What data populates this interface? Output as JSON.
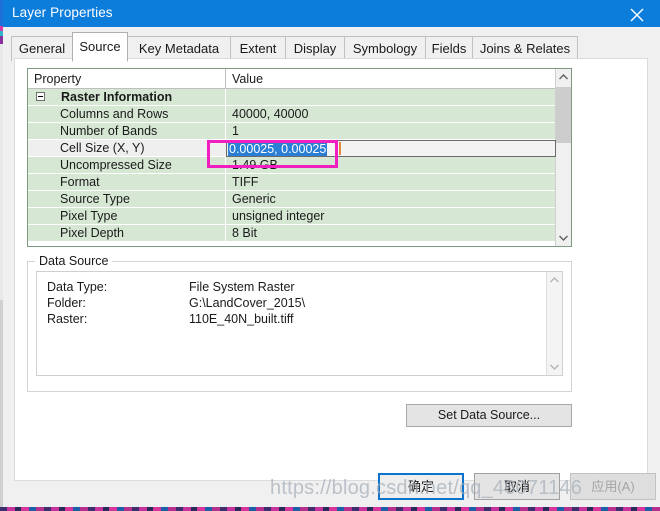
{
  "window": {
    "title": "Layer Properties",
    "close_icon": "close-icon",
    "titlebar_color": "#0d7ddb"
  },
  "tabs": [
    {
      "label": "General",
      "active": false
    },
    {
      "label": "Source",
      "active": true
    },
    {
      "label": "Key Metadata",
      "active": false
    },
    {
      "label": "Extent",
      "active": false
    },
    {
      "label": "Display",
      "active": false
    },
    {
      "label": "Symbology",
      "active": false
    },
    {
      "label": "Fields",
      "active": false
    },
    {
      "label": "Joins & Relates",
      "active": false
    }
  ],
  "grid": {
    "headers": {
      "property": "Property",
      "value": "Value"
    },
    "rows": [
      {
        "name": "Raster Information",
        "value": "",
        "group": true,
        "expanded": true
      },
      {
        "name": "Columns and Rows",
        "value": "40000, 40000"
      },
      {
        "name": "Number of Bands",
        "value": "1"
      },
      {
        "name": "Cell Size (X, Y)",
        "value": "0.00025, 0.00025",
        "editing": true,
        "selected": true
      },
      {
        "name": "Uncompressed Size",
        "value": "1.49 GB"
      },
      {
        "name": "Format",
        "value": "TIFF"
      },
      {
        "name": "Source Type",
        "value": "Generic"
      },
      {
        "name": "Pixel Type",
        "value": "unsigned integer"
      },
      {
        "name": "Pixel Depth",
        "value": "8 Bit"
      }
    ],
    "editor_value": "0.00025, 0.00025",
    "row_background": "#d6e8d4",
    "selection_color": "#2a7fd4"
  },
  "annotation": {
    "color": "#f21fc0",
    "target": "Cell Size (X, Y) value"
  },
  "data_source": {
    "legend": "Data Source",
    "lines": [
      {
        "label": "Data Type:",
        "value": "File System Raster"
      },
      {
        "label": "Folder:",
        "value": "G:\\LandCover_2015\\"
      },
      {
        "label": "Raster:",
        "value": "110E_40N_built.tiff"
      }
    ]
  },
  "buttons": {
    "set_data_source": "Set Data Source...",
    "ok": "确定",
    "cancel": "取消",
    "apply": "应用(A)"
  },
  "watermark": {
    "text": "https://blog.csdn.net/qq_46071146"
  }
}
